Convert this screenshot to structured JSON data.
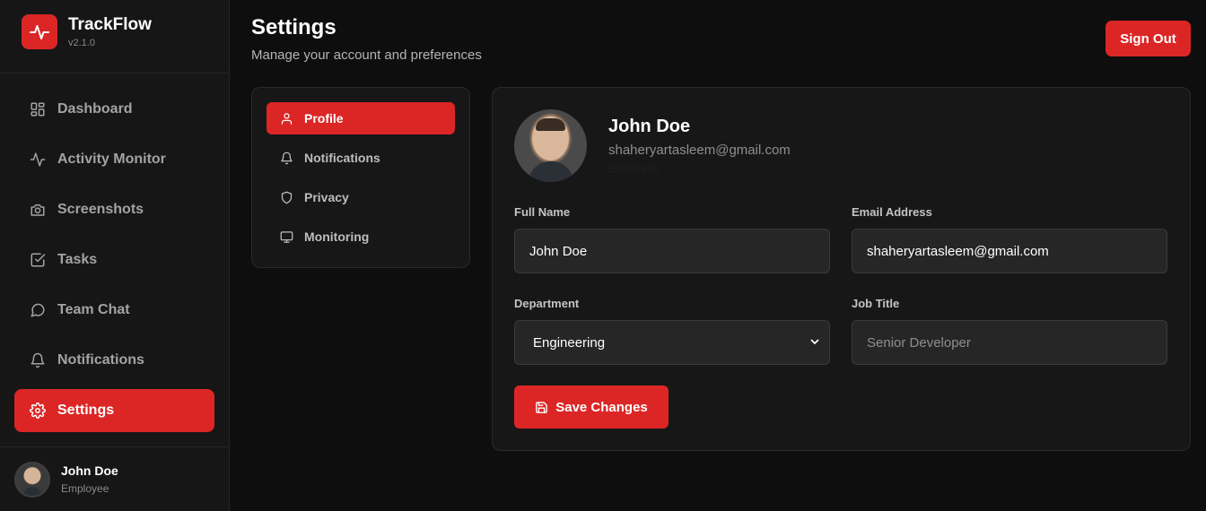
{
  "brand": {
    "name": "TrackFlow",
    "version": "v2.1.0"
  },
  "sidebar": {
    "items": [
      {
        "label": "Dashboard",
        "icon": "dashboard-icon"
      },
      {
        "label": "Activity Monitor",
        "icon": "activity-icon"
      },
      {
        "label": "Screenshots",
        "icon": "camera-icon"
      },
      {
        "label": "Tasks",
        "icon": "checkbox-icon"
      },
      {
        "label": "Team Chat",
        "icon": "chat-icon"
      },
      {
        "label": "Notifications",
        "icon": "bell-icon"
      },
      {
        "label": "Settings",
        "icon": "gear-icon",
        "active": true
      }
    ]
  },
  "user": {
    "name": "John Doe",
    "role": "Employee"
  },
  "header": {
    "title": "Settings",
    "subtitle": "Manage your account and preferences",
    "signout_label": "Sign Out"
  },
  "settings_nav": {
    "items": [
      {
        "label": "Profile",
        "icon": "user-icon",
        "active": true
      },
      {
        "label": "Notifications",
        "icon": "bell-icon"
      },
      {
        "label": "Privacy",
        "icon": "shield-icon"
      },
      {
        "label": "Monitoring",
        "icon": "monitor-icon"
      }
    ]
  },
  "profile": {
    "name": "John Doe",
    "email": "shaheryartasleem@gmail.com",
    "role": "Employee",
    "fields": {
      "full_name": {
        "label": "Full Name",
        "value": "John Doe"
      },
      "email": {
        "label": "Email Address",
        "value": "shaheryartasleem@gmail.com"
      },
      "department": {
        "label": "Department",
        "value": "Engineering"
      },
      "job_title": {
        "label": "Job Title",
        "placeholder": "Senior Developer"
      }
    },
    "save_label": "Save Changes"
  },
  "colors": {
    "accent": "#dc2626",
    "background": "#0e0e0e",
    "panel": "#171717"
  }
}
